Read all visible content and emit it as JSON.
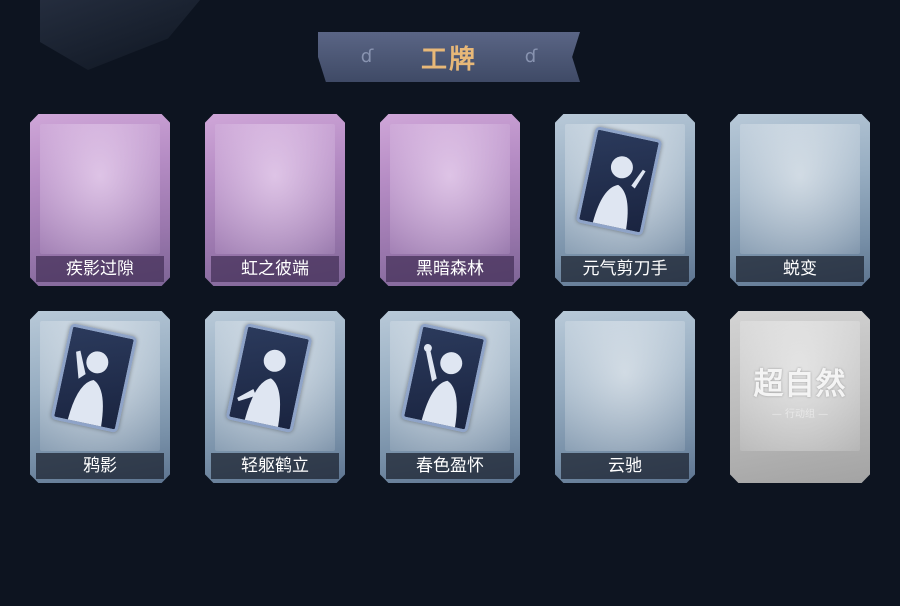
{
  "header": {
    "title": "工牌"
  },
  "cards": [
    {
      "label": "疾影过隙",
      "tint": "purple",
      "portrait": false
    },
    {
      "label": "虹之彼端",
      "tint": "purple",
      "portrait": false
    },
    {
      "label": "黑暗森林",
      "tint": "purple",
      "portrait": false
    },
    {
      "label": "元气剪刀手",
      "tint": "blue",
      "portrait": true,
      "icon": "peace-sign-figure-icon"
    },
    {
      "label": "蜕变",
      "tint": "blue",
      "portrait": false
    },
    {
      "label": "鸦影",
      "tint": "blue",
      "portrait": true,
      "icon": "salute-figure-icon"
    },
    {
      "label": "轻躯鹤立",
      "tint": "blue",
      "portrait": true,
      "icon": "graceful-figure-icon"
    },
    {
      "label": "春色盈怀",
      "tint": "blue",
      "portrait": true,
      "icon": "flower-figure-icon"
    },
    {
      "label": "云驰",
      "tint": "blue",
      "portrait": false
    },
    {
      "label": "",
      "tint": "white",
      "portrait": false,
      "logo": {
        "main": "超自然",
        "sub": "— 行动组 —"
      }
    }
  ]
}
